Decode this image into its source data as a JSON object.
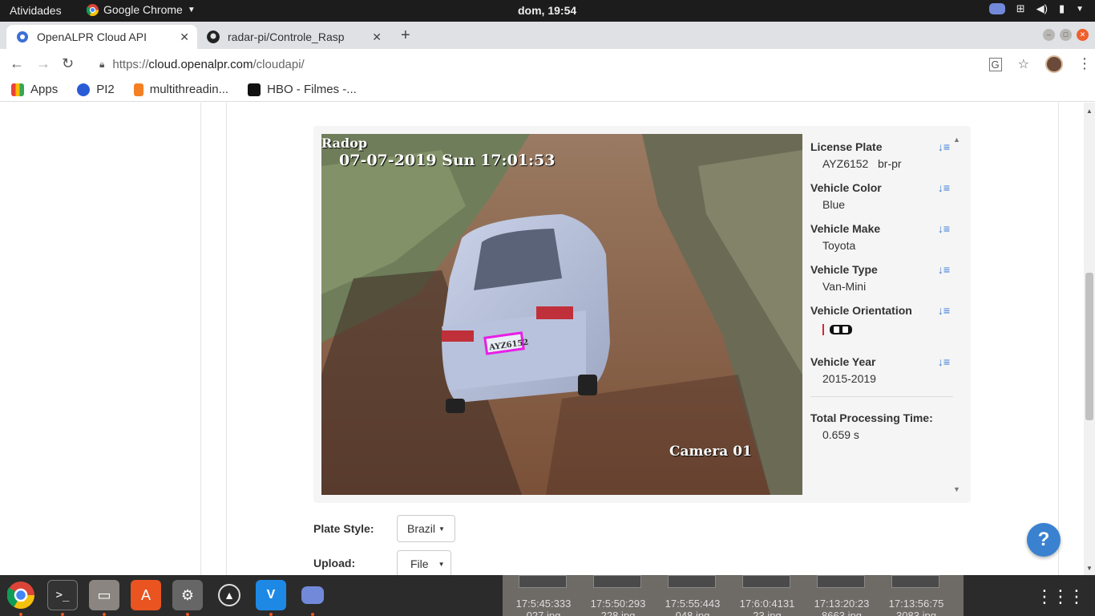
{
  "system_bar": {
    "activities": "Atividades",
    "app_name": "Google Chrome",
    "clock": "dom, 19:54"
  },
  "tabs": [
    {
      "title": "OpenALPR Cloud API",
      "active": true
    },
    {
      "title": "radar-pi/Controle_Rasp",
      "active": false
    }
  ],
  "address": {
    "scheme": "https://",
    "host": "cloud.openalpr.com",
    "path": "/cloudapi/"
  },
  "bookmarks": [
    {
      "label": "Apps",
      "icon": "apps-grid-icon"
    },
    {
      "label": "PI2",
      "icon": "pi2-icon"
    },
    {
      "label": "multithreadin...",
      "icon": "stackoverflow-icon"
    },
    {
      "label": "HBO - Filmes -...",
      "icon": "hbo-icon"
    }
  ],
  "photo": {
    "overlay_top_left": "Radop",
    "timestamp": "07-07-2019 Sun 17:01:53",
    "camera": "Camera 01",
    "plate_text": "AYZ6152"
  },
  "results": {
    "license_plate": {
      "label": "License Plate",
      "value": "AYZ6152",
      "region": "br-pr"
    },
    "vehicle_color": {
      "label": "Vehicle Color",
      "value": "Blue"
    },
    "vehicle_make": {
      "label": "Vehicle Make",
      "value": "Toyota"
    },
    "vehicle_type": {
      "label": "Vehicle Type",
      "value": "Van-Mini"
    },
    "vehicle_orientation": {
      "label": "Vehicle Orientation"
    },
    "vehicle_year": {
      "label": "Vehicle Year",
      "value": "2015-2019"
    },
    "processing": {
      "label": "Total Processing Time:",
      "value": "0.659 s"
    }
  },
  "form": {
    "plate_style_label": "Plate Style:",
    "plate_style_value": "Brazil",
    "upload_label": "Upload:",
    "upload_value": "File"
  },
  "help_button": "?",
  "desktop_files": [
    {
      "line1": "17:5:45:333",
      "line2": "027.jpg"
    },
    {
      "line1": "17:5:50:293",
      "line2": "228.jpg"
    },
    {
      "line1": "17:5:55:443",
      "line2": "048.jpg"
    },
    {
      "line1": "17:6:0:4131",
      "line2": "23.jpg"
    },
    {
      "line1": "17:13:20:23",
      "line2": "8663.jpg"
    },
    {
      "line1": "17:13:56:75",
      "line2": "3083.jpg"
    }
  ],
  "colors": {
    "accent": "#3a7bd5",
    "plate_box": "#e81ee6",
    "help": "#3a82d0",
    "ubuntu_orange": "#e95420"
  }
}
